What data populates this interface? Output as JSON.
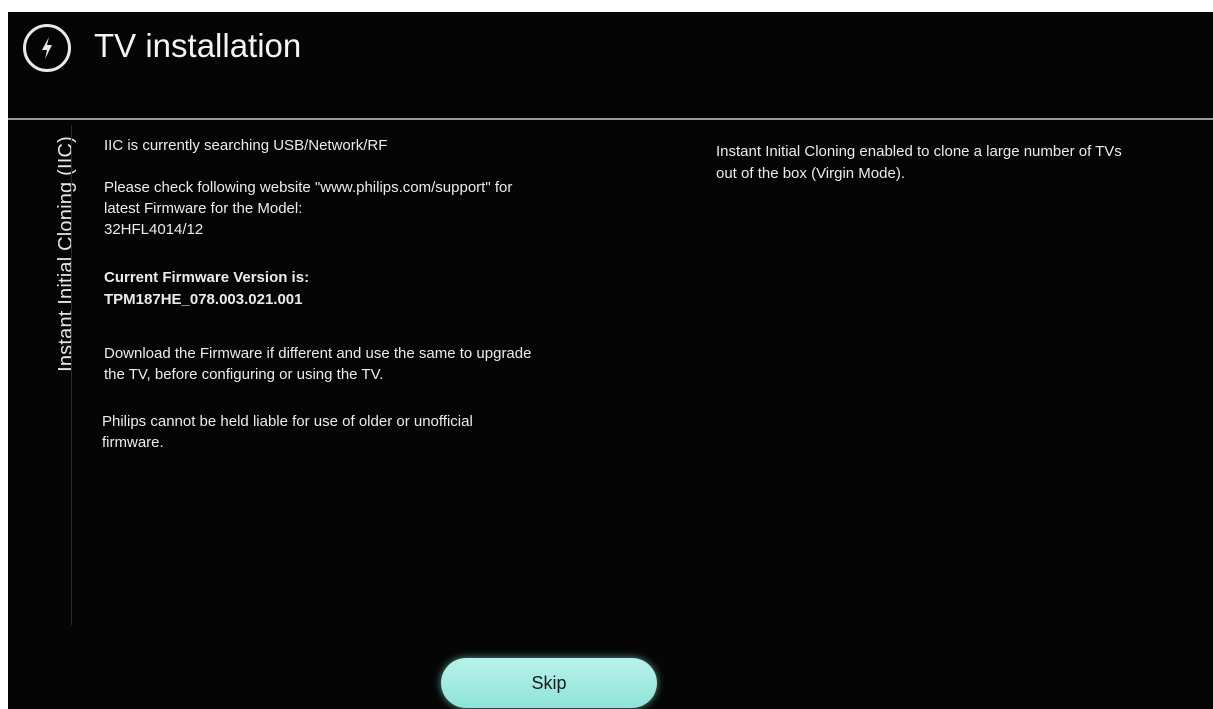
{
  "header": {
    "title": "TV installation",
    "icon": "installation-icon"
  },
  "sidebar": {
    "label": "Instant Initial Cloning (IIC)"
  },
  "main": {
    "searching": "IIC is currently searching USB/Network/RF",
    "check_website_line1": "Please check following website \"www.philips.com/support\" for",
    "check_website_line2": "latest Firmware for the Model:",
    "model": "32HFL4014/12",
    "firmware_label": "Current Firmware Version is:",
    "firmware_version": "TPM187HE_078.003.021.001",
    "download_line1": "Download the Firmware if different and use the same to upgrade",
    "download_line2": "the TV, before configuring or using the TV.",
    "liability_line1": "Philips cannot be held liable for use of older or unofficial",
    "liability_line2": "firmware."
  },
  "info": {
    "line1": "Instant Initial Cloning  enabled to clone a large number of TVs",
    "line2": "out of the box (Virgin Mode)."
  },
  "buttons": {
    "skip_label": "Skip"
  },
  "colors": {
    "background": "#050505",
    "text": "#ececec",
    "skip_button": "#a8eee4"
  }
}
